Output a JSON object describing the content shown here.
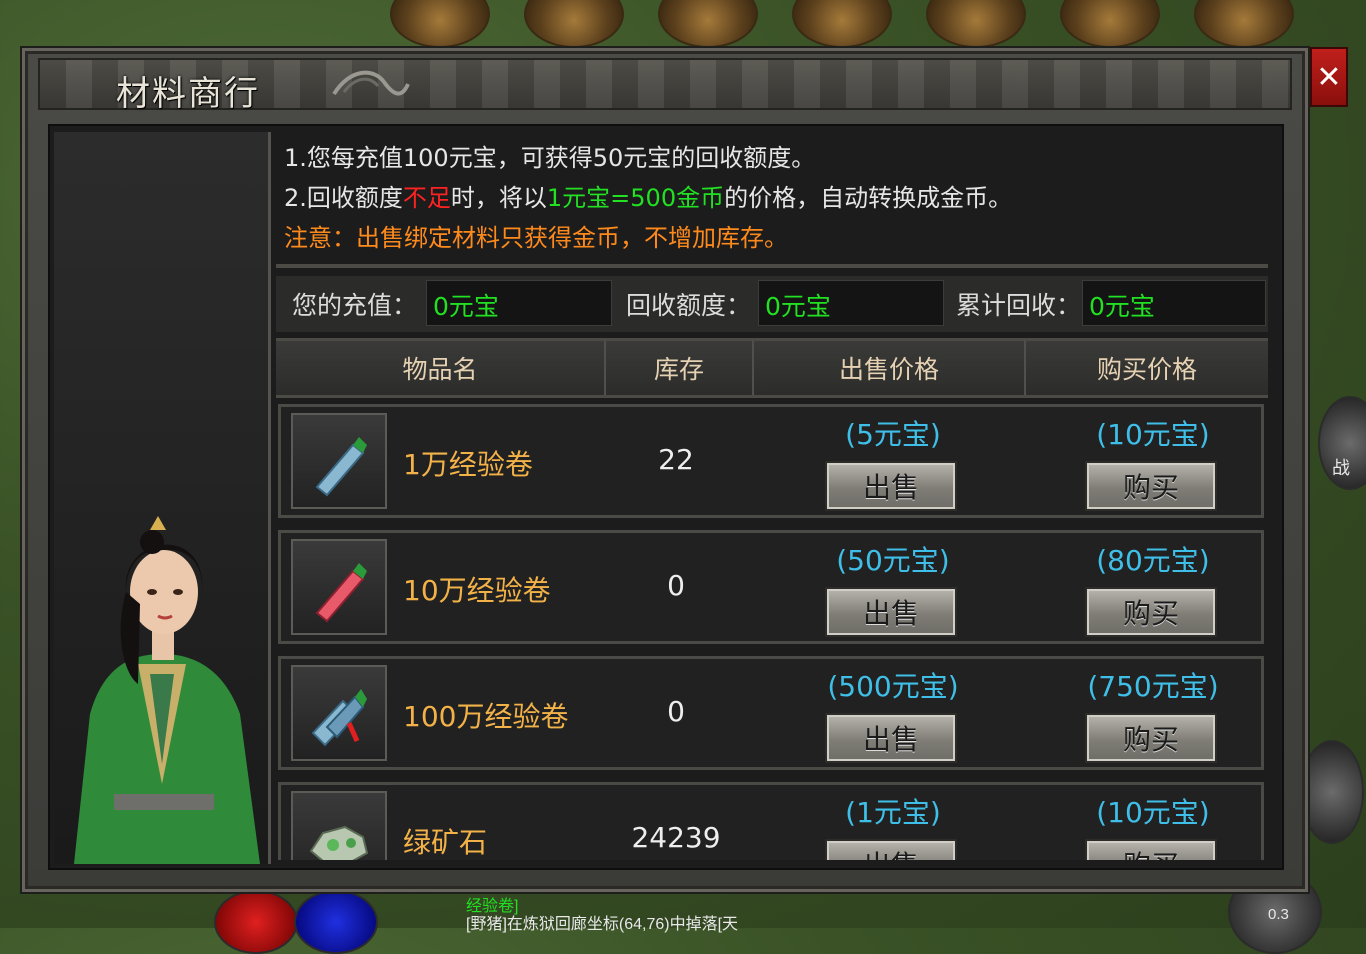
{
  "window": {
    "title": "材料商行",
    "close_label": "✕"
  },
  "notes": {
    "line1": "1.您每充值100元宝，可获得50元宝的回收额度。",
    "line2_a": "2.回收额度",
    "line2_b": "不足",
    "line2_c": "时，将以",
    "line2_d": "1元宝=500金币",
    "line2_e": "的价格，自动转换成金币。",
    "line3": "注意：出售绑定材料只获得金币，不增加库存。"
  },
  "stats": {
    "recharge_label": "您的充值：",
    "recharge_value": "0元宝",
    "quota_label": "回收额度：",
    "quota_value": "0元宝",
    "total_label": "累计回收：",
    "total_value": "0元宝"
  },
  "table": {
    "headers": [
      "物品名",
      "库存",
      "出售价格",
      "购买价格"
    ],
    "sell_label": "出售",
    "buy_label": "购买",
    "rows": [
      {
        "name": "1万经验卷",
        "stock": "22",
        "sell_price": "(5元宝)",
        "buy_price": "(10元宝)",
        "icon": "blue-scroll-icon"
      },
      {
        "name": "10万经验卷",
        "stock": "0",
        "sell_price": "(50元宝)",
        "buy_price": "(80元宝)",
        "icon": "red-scroll-icon"
      },
      {
        "name": "100万经验卷",
        "stock": "0",
        "sell_price": "(500元宝)",
        "buy_price": "(750元宝)",
        "icon": "blue-scroll-bundle-icon"
      },
      {
        "name": "绿矿石",
        "stock": "24239",
        "sell_price": "(1元宝)",
        "buy_price": "(10元宝)",
        "icon": "green-ore-icon"
      }
    ]
  },
  "background": {
    "chat_line1": "经验卷]",
    "chat_line2": "[野猪]在炼狱回廊坐标(64,76)中掉落[天",
    "version": "0.3",
    "side_button": "战"
  },
  "colors": {
    "accent_green": "#22e022",
    "warning_red": "#ff2222",
    "notice_orange": "#ff8a1c",
    "price_blue": "#3fbfe8",
    "item_gold": "#f3b248"
  }
}
